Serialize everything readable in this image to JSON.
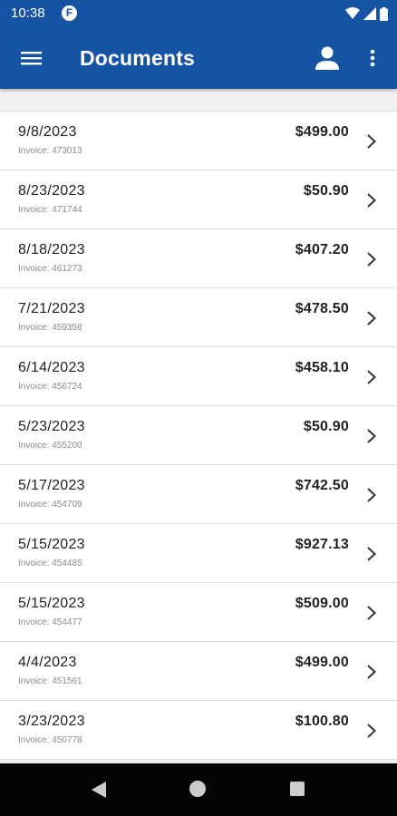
{
  "status_bar": {
    "time": "10:38",
    "app_icon_letter": "F"
  },
  "app_bar": {
    "title": "Documents",
    "menu_icon": "hamburger-icon",
    "account_icon": "person-icon",
    "overflow_icon": "more-vert-icon",
    "color": "#1753a3"
  },
  "documents": [
    {
      "date": "9/8/2023",
      "invoice": "Invoice: 473013",
      "amount": "$499.00"
    },
    {
      "date": "8/23/2023",
      "invoice": "Invoice: 471744",
      "amount": "$50.90"
    },
    {
      "date": "8/18/2023",
      "invoice": "Invoice: 461273",
      "amount": "$407.20"
    },
    {
      "date": "7/21/2023",
      "invoice": "Invoice: 459358",
      "amount": "$478.50"
    },
    {
      "date": "6/14/2023",
      "invoice": "Invoice: 456724",
      "amount": "$458.10"
    },
    {
      "date": "5/23/2023",
      "invoice": "Invoice: 455200",
      "amount": "$50.90"
    },
    {
      "date": "5/17/2023",
      "invoice": "Invoice: 454709",
      "amount": "$742.50"
    },
    {
      "date": "5/15/2023",
      "invoice": "Invoice: 454485",
      "amount": "$927.13"
    },
    {
      "date": "5/15/2023",
      "invoice": "Invoice: 454477",
      "amount": "$509.00"
    },
    {
      "date": "4/4/2023",
      "invoice": "Invoice: 451561",
      "amount": "$499.00"
    },
    {
      "date": "3/23/2023",
      "invoice": "Invoice: 450778",
      "amount": "$100.80"
    }
  ],
  "nav_bar": {
    "back_icon": "back-triangle-icon",
    "home_icon": "home-circle-icon",
    "recents_icon": "recents-square-icon"
  }
}
